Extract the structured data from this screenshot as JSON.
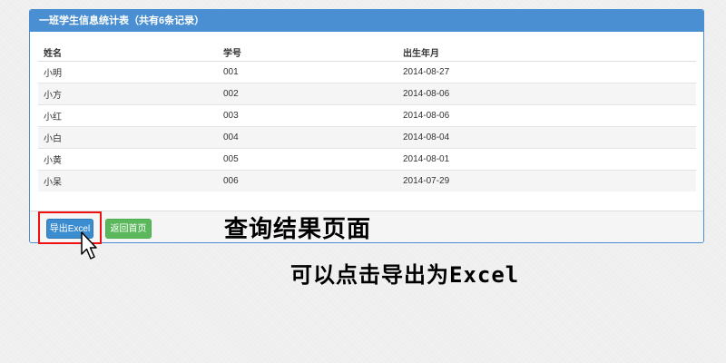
{
  "panel": {
    "title": "一班学生信息统计表（共有6条记录）"
  },
  "table": {
    "headers": [
      "姓名",
      "学号",
      "出生年月"
    ],
    "rows": [
      [
        "小明",
        "001",
        "2014-08-27"
      ],
      [
        "小方",
        "002",
        "2014-08-06"
      ],
      [
        "小红",
        "003",
        "2014-08-06"
      ],
      [
        "小白",
        "004",
        "2014-08-04"
      ],
      [
        "小黄",
        "005",
        "2014-08-01"
      ],
      [
        "小呆",
        "006",
        "2014-07-29"
      ]
    ]
  },
  "buttons": {
    "export_label": "导出Excel",
    "back_label": "返回首页"
  },
  "annotations": {
    "line1": "查询结果页面",
    "line2": "可以点击导出为Excel"
  },
  "colors": {
    "primary": "#4a8fd1",
    "success": "#5cb85c",
    "highlight": "#ee1111"
  },
  "icons": {
    "pointer": "mouse-pointer-icon"
  }
}
